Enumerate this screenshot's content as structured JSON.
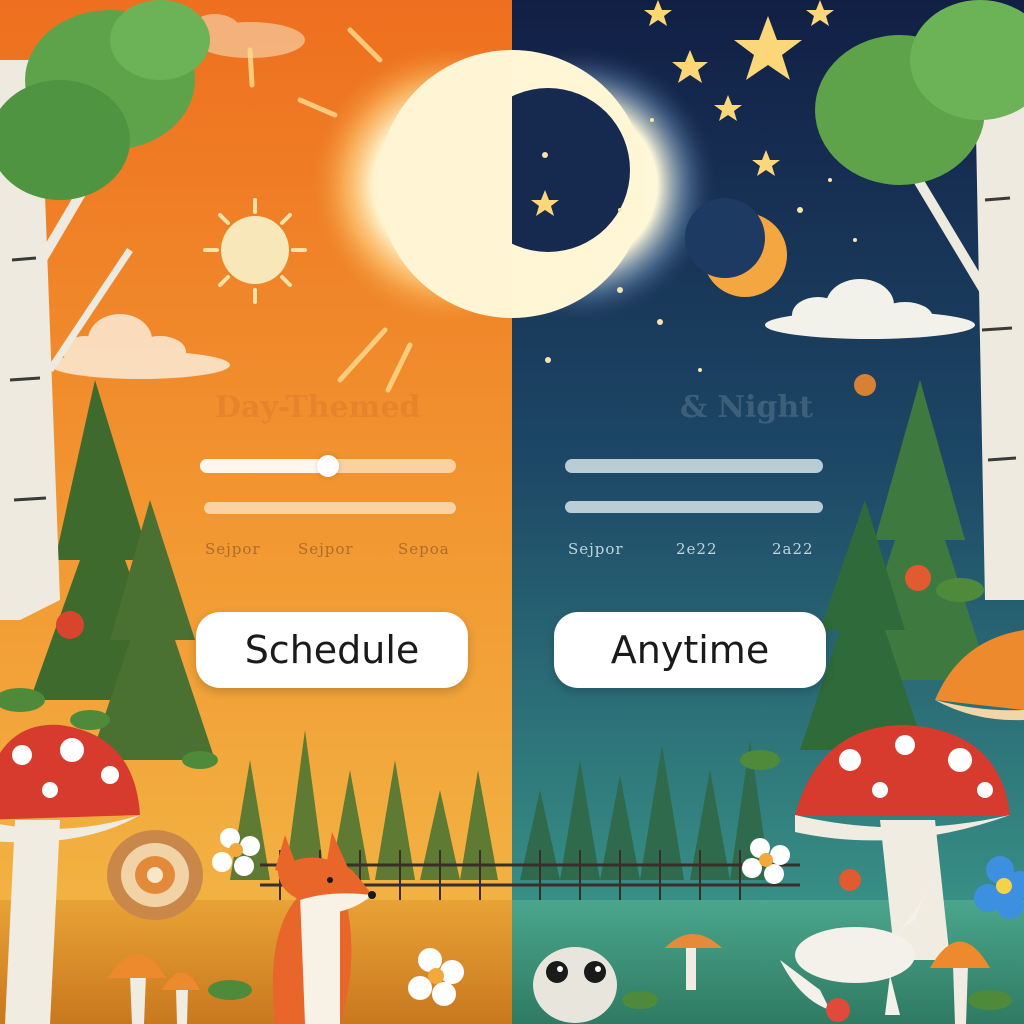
{
  "day_panel": {
    "ghost_title": "Day-Themed",
    "labels": [
      "Sejpor",
      "Sejpor",
      "Sepoa"
    ],
    "button_label": "Schedule",
    "slider_level": 0.5
  },
  "night_panel": {
    "ghost_title": "& Night",
    "labels": [
      "Sejpor",
      "2e22",
      "2a22"
    ],
    "button_label": "Anytime"
  },
  "colors": {
    "day_top": "#f07a22",
    "day_bottom": "#f2b33c",
    "night_top": "#15244a",
    "night_bottom": "#3a9a8a",
    "sun": "#fbeec0",
    "mushroom_red": "#d63b2e",
    "fox": "#e8662a"
  },
  "icons": [
    "sun-icon",
    "moon-icon",
    "star-icon",
    "cloud-icon",
    "tree-icon",
    "mushroom-icon",
    "fox-icon",
    "flower-icon"
  ]
}
